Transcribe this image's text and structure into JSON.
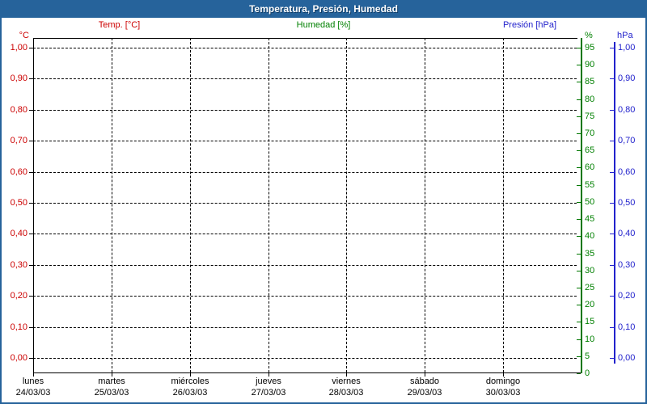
{
  "window": {
    "title": "Temperatura, Presión, Humedad"
  },
  "legend": {
    "items": [
      {
        "label": "Temp. [°C]"
      },
      {
        "label": "Humedad [%]"
      },
      {
        "label": "Presión [hPa]"
      }
    ]
  },
  "axes": {
    "temp": {
      "unit": "°C",
      "ticks": [
        "1,00",
        "0,90",
        "0,80",
        "0,70",
        "0,60",
        "0,50",
        "0,40",
        "0,30",
        "0,20",
        "0,10",
        "0,00"
      ]
    },
    "humidity": {
      "unit": "%",
      "ticks": [
        "95",
        "90",
        "85",
        "80",
        "75",
        "70",
        "65",
        "60",
        "55",
        "50",
        "45",
        "40",
        "35",
        "30",
        "25",
        "20",
        "15",
        "10",
        "5",
        "0"
      ]
    },
    "pressure": {
      "unit": "hPa",
      "ticks": [
        "1,00",
        "0,90",
        "0,80",
        "0,70",
        "0,60",
        "0,50",
        "0,40",
        "0,30",
        "0,20",
        "0,10",
        "0,00"
      ]
    }
  },
  "x_axis": {
    "days": [
      {
        "name": "lunes",
        "date": "24/03/03"
      },
      {
        "name": "martes",
        "date": "25/03/03"
      },
      {
        "name": "miércoles",
        "date": "26/03/03"
      },
      {
        "name": "jueves",
        "date": "27/03/03"
      },
      {
        "name": "viernes",
        "date": "28/03/03"
      },
      {
        "name": "sábado",
        "date": "29/03/03"
      },
      {
        "name": "domingo",
        "date": "30/03/03"
      }
    ]
  },
  "colors": {
    "temp": "#cc0000",
    "humidity_text": "#008000",
    "humidity_axis": "#007700",
    "pressure": "#2222cc",
    "frame": "#26639b",
    "grid": "#000000"
  },
  "chart_data": {
    "type": "line",
    "title": "Temperatura, Presión, Humedad",
    "x_day_names": [
      "lunes",
      "martes",
      "miércoles",
      "jueves",
      "viernes",
      "sábado",
      "domingo"
    ],
    "x_categories": [
      "24/03/03",
      "25/03/03",
      "26/03/03",
      "27/03/03",
      "28/03/03",
      "29/03/03",
      "30/03/03"
    ],
    "series": [
      {
        "name": "Temp. [°C]",
        "axis": "temp",
        "color": "#cc0000",
        "values": []
      },
      {
        "name": "Humedad [%]",
        "axis": "humidity",
        "color": "#008000",
        "values": []
      },
      {
        "name": "Presión [hPa]",
        "axis": "pressure",
        "color": "#2222cc",
        "values": []
      }
    ],
    "y_axes": [
      {
        "id": "temp",
        "unit": "°C",
        "min": 0.0,
        "max": 1.0,
        "step": 0.1,
        "position": "left"
      },
      {
        "id": "humidity",
        "unit": "%",
        "min": 0,
        "max": 95,
        "step": 5,
        "position": "right-inner"
      },
      {
        "id": "pressure",
        "unit": "hPa",
        "min": 0.0,
        "max": 1.0,
        "step": 0.1,
        "position": "right-outer"
      }
    ],
    "grid": true,
    "legend_position": "top"
  }
}
